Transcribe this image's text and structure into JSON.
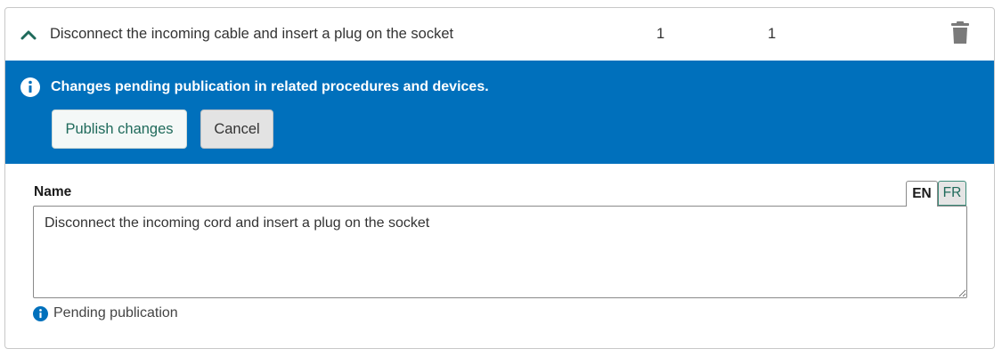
{
  "row": {
    "title": "Disconnect the incoming cable and insert a plug on the socket",
    "count_1": "1",
    "count_2": "1",
    "expand_icon": "chevron-up-icon",
    "delete_icon": "trash-icon"
  },
  "banner": {
    "message": "Changes pending publication in related procedures and devices.",
    "icon": "info-icon",
    "publish_label": "Publish changes",
    "cancel_label": "Cancel",
    "color": "#0070bc"
  },
  "form": {
    "name_label": "Name",
    "languages": [
      "EN",
      "FR"
    ],
    "active_language": "EN",
    "name_value": "Disconnect the incoming cord and insert a plug on the socket",
    "status_text": "Pending publication",
    "status_icon": "info-icon"
  },
  "colors": {
    "accent_teal": "#1f6a5b",
    "info_blue": "#0070bc"
  }
}
